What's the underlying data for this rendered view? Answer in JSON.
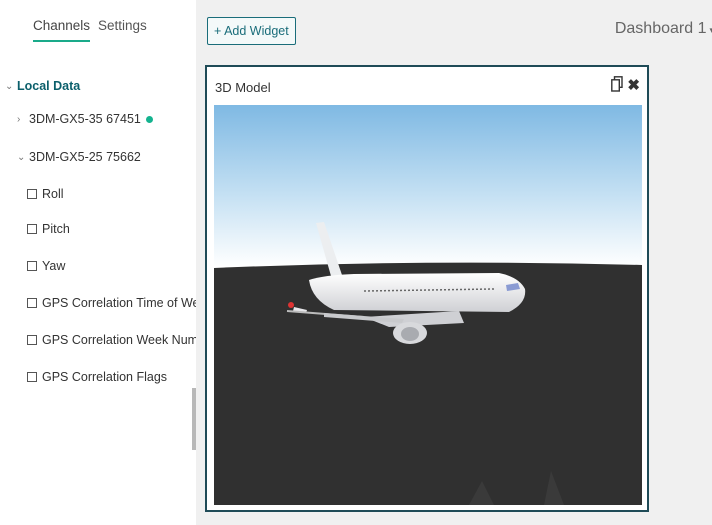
{
  "sidebar": {
    "tabs": [
      {
        "label": "Channels",
        "active": true
      },
      {
        "label": "Settings",
        "active": false
      }
    ],
    "tree": {
      "root_label": "Local Data",
      "devices": [
        {
          "label": "3DM-GX5-35 67451",
          "expanded": false,
          "status": "connected"
        },
        {
          "label": "3DM-GX5-25 75662",
          "expanded": true
        }
      ],
      "channels": [
        {
          "label": "Roll",
          "checked": false
        },
        {
          "label": "Pitch",
          "checked": false
        },
        {
          "label": "Yaw",
          "checked": false
        },
        {
          "label": "GPS Correlation Time of Wee",
          "checked": false
        },
        {
          "label": "GPS Correlation Week Numbe",
          "checked": false
        },
        {
          "label": "GPS Correlation Flags",
          "checked": false
        }
      ]
    }
  },
  "toolbar": {
    "add_widget_label": "+ Add Widget",
    "dashboard_label": "Dashboard 1"
  },
  "widget": {
    "title": "3D Model",
    "copy_icon": "copy-icon",
    "close_icon": "close-icon",
    "colors": {
      "sky_top": "#7fb9e3",
      "sky_bottom": "#ffffff",
      "ground": "#303030",
      "border": "#1f4b57"
    }
  },
  "colors": {
    "accent": "#1aaa8a",
    "root_label": "#0b5f6b",
    "status_dot": "#14b38f"
  }
}
